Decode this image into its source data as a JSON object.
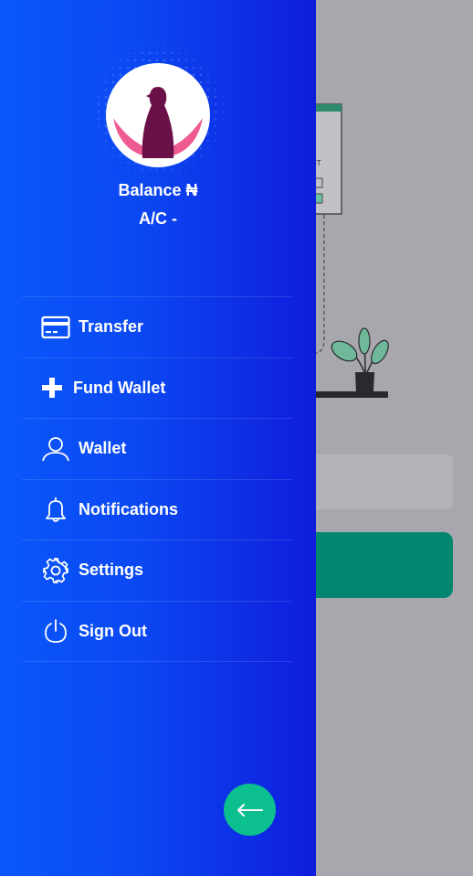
{
  "drawer": {
    "balance_label": "Balance ₦",
    "account_label": "A/C -",
    "menu": [
      {
        "label": "Transfer",
        "icon": "credit-card-icon"
      },
      {
        "label": "Fund Wallet",
        "icon": "plus-icon"
      },
      {
        "label": "Wallet",
        "icon": "user-icon"
      },
      {
        "label": "Notifications",
        "icon": "bell-icon"
      },
      {
        "label": "Settings",
        "icon": "gear-icon"
      },
      {
        "label": "Sign Out",
        "icon": "power-icon"
      }
    ],
    "back_button_icon": "arrow-left-icon"
  },
  "colors": {
    "drawer_gradient_start": "#0a58fb",
    "drawer_gradient_end": "#0f1cdc",
    "fab": "#0cbf8f",
    "background_button": "#028670",
    "overlay_background": "#a8a7ad",
    "avatar_figure": "#6b1149",
    "avatar_accent": "#ef5a93"
  },
  "background_app": {
    "illustration_text": "NT"
  }
}
